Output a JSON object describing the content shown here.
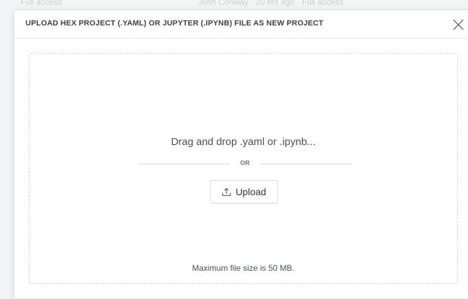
{
  "background": {
    "top_left_text": "Full access",
    "top_right_text": "John Conway · 20 hrs ago · Full access"
  },
  "modal": {
    "title": "UPLOAD HEX PROJECT (.YAML) OR JUPYTER (.IPYNB) FILE AS NEW PROJECT",
    "close_icon": "close-icon",
    "dropzone": {
      "instruction": "Drag and drop .yaml or .ipynb...",
      "divider_text": "OR",
      "upload_button_label": "Upload",
      "upload_icon": "upload-icon",
      "max_size_note": "Maximum file size is 50 MB."
    }
  },
  "colors": {
    "title_text": "#3a3f47",
    "border": "#e3e5e8",
    "dashed_border": "#d4d7db",
    "body_text": "#4a4f57"
  }
}
